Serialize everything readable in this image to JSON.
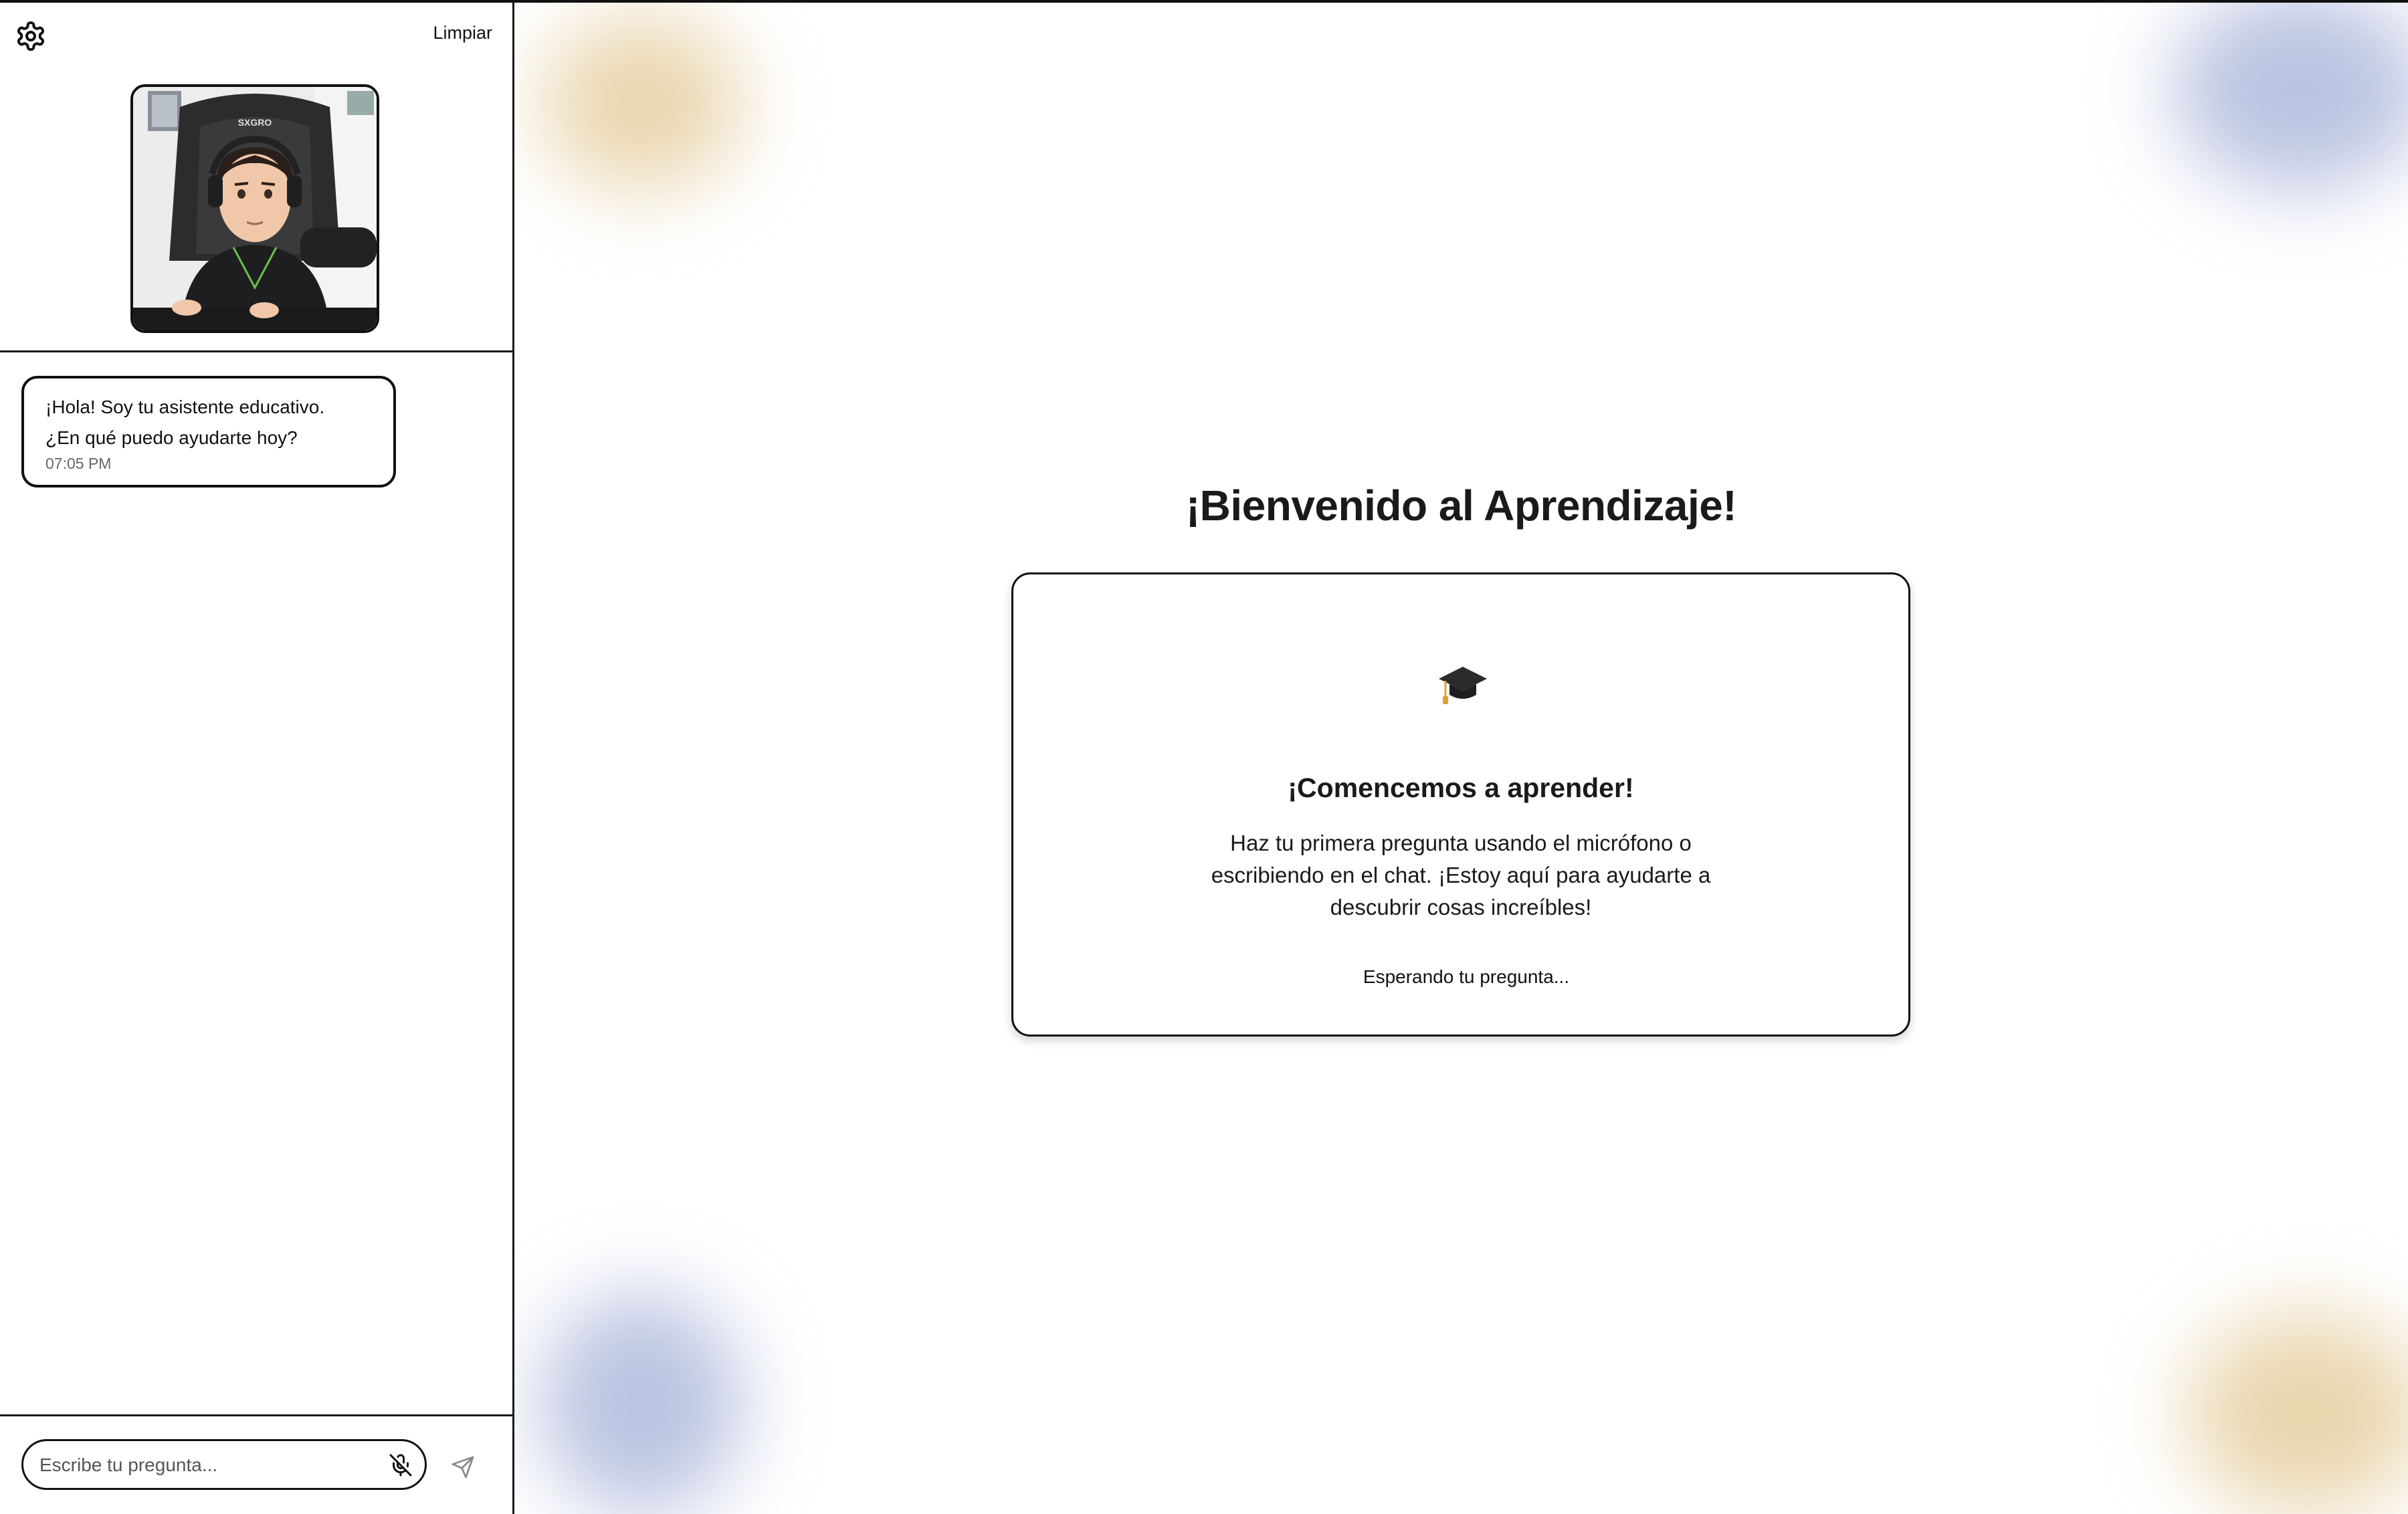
{
  "sidebar": {
    "settings_icon": "gear-icon",
    "clear_label": "Limpiar",
    "avatar_alt": "avatar",
    "messages": [
      {
        "text_line1": "¡Hola! Soy tu asistente educativo.",
        "text_line2": "¿En qué puedo ayudarte hoy?",
        "time": "07:05 PM"
      }
    ],
    "input": {
      "placeholder": "Escribe tu pregunta...",
      "value": "",
      "mic_icon": "mic-off-icon",
      "send_icon": "send-icon"
    }
  },
  "main": {
    "title": "¡Bienvenido al Aprendizaje!",
    "card": {
      "icon": "graduation-cap-icon",
      "heading": "¡Comencemos a aprender!",
      "text_line1": "Haz tu primera pregunta usando el micrófono o",
      "text_line2": "escribiendo en el chat. ¡Estoy aquí para ayudarte a",
      "text_line3": "descubrir cosas increíbles!",
      "status": "Esperando tu pregunta..."
    }
  },
  "colors": {
    "border": "#111111",
    "accent_gold": "#d7b46e",
    "accent_blue": "#8291c8"
  }
}
